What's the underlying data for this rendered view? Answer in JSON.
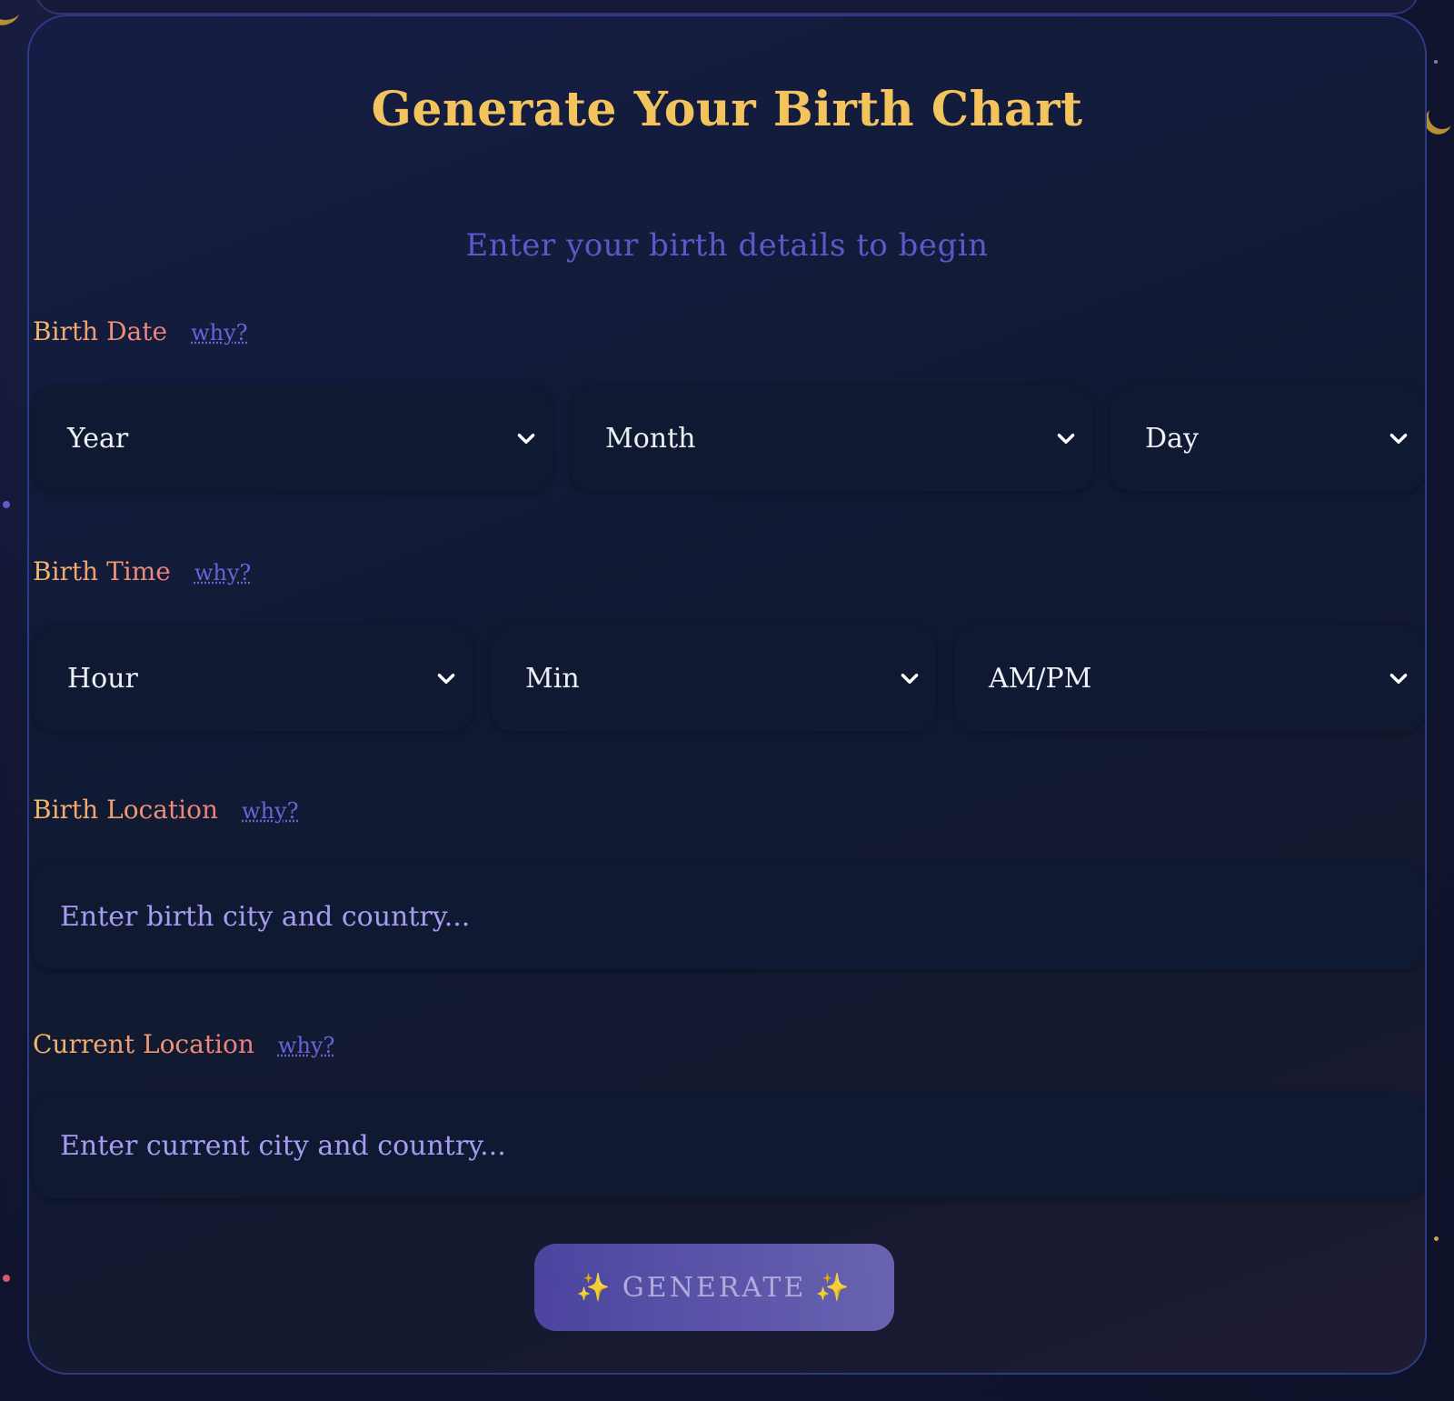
{
  "form": {
    "title": "Generate Your Birth Chart",
    "subtitle": "Enter your birth details to begin",
    "why_label": "why?",
    "birth_date": {
      "label": "Birth Date",
      "selects": [
        "Year",
        "Month",
        "Day"
      ]
    },
    "birth_time": {
      "label": "Birth Time",
      "selects": [
        "Hour",
        "Min",
        "AM/PM"
      ]
    },
    "birth_location": {
      "label": "Birth Location",
      "placeholder": "Enter birth city and country..."
    },
    "current_location": {
      "label": "Current Location",
      "placeholder": "Enter current city and country..."
    },
    "generate_button": {
      "label": "GENERATE",
      "sparkle_icon": "✨"
    }
  },
  "colors": {
    "title": "#f3c45e",
    "subtitle": "#5b59c9",
    "link": "#6b62d8",
    "field_bg": "#0f1932",
    "button": "#5a53ad"
  }
}
